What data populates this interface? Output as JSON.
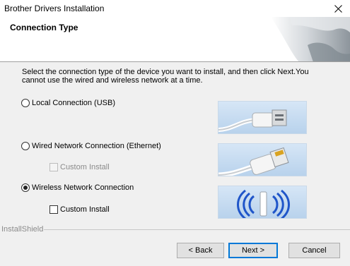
{
  "window": {
    "title": "Brother Drivers Installation"
  },
  "header": {
    "title": "Connection Type"
  },
  "instructions": "Select the connection type of the device you want to install, and then click Next.You cannot use the wired and wireless network at a time.",
  "options": {
    "local": {
      "label": "Local Connection (USB)",
      "selected": false,
      "icon": "usb-cable-illustration"
    },
    "wired": {
      "label": "Wired Network Connection (Ethernet)",
      "selected": false,
      "icon": "ethernet-cable-illustration",
      "custom_label": "Custom Install",
      "custom_enabled": false
    },
    "wireless": {
      "label": "Wireless Network Connection",
      "selected": true,
      "icon": "wireless-illustration",
      "custom_label": "Custom Install",
      "custom_enabled": true
    }
  },
  "footer": {
    "brand": "InstallShield"
  },
  "buttons": {
    "back": "< Back",
    "next": "Next >",
    "cancel": "Cancel"
  },
  "colors": {
    "accent": "#0078d7",
    "picture_bg": "#c6dcf2",
    "wireless_blue": "#1f55c9"
  }
}
